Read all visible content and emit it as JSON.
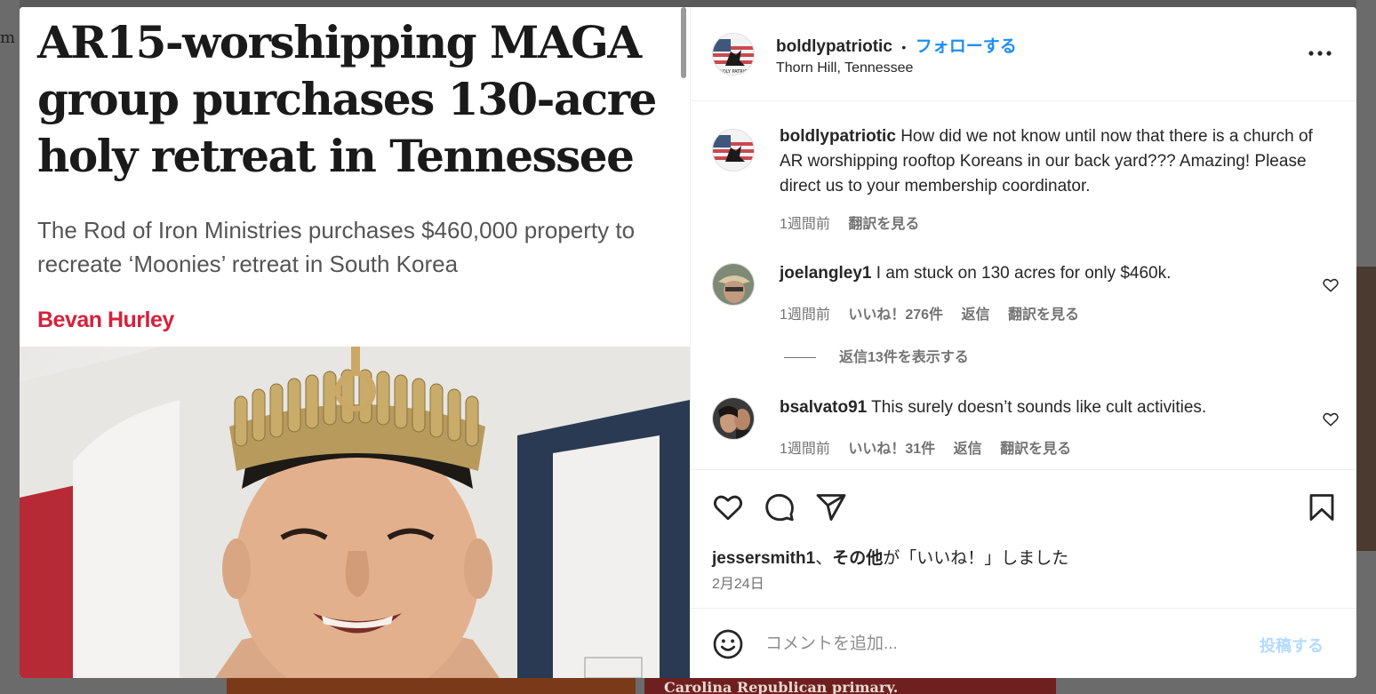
{
  "article": {
    "headline": "AR15-worshipping MAGA group purchases 130-acre holy retreat in Tennessee",
    "subhead": "The Rod of Iron Ministries purchases $460,000 property to recreate ‘Moonies’ retreat in South Korea",
    "byline": "Bevan Hurley"
  },
  "post": {
    "username": "boldlypatriotic",
    "separator": "•",
    "follow_label": "フォローする",
    "location": "Thorn Hill, Tennessee",
    "more_label": "•••"
  },
  "comments": [
    {
      "username": "boldlypatriotic",
      "text": "How did we not know until now that there is a church of AR worshipping rooftop Koreans in our back yard??? Amazing! Please direct us to your membership coordinator.",
      "time": "1週間前",
      "translate": "翻訳を見る"
    },
    {
      "username": "joelangley1",
      "text": "I am stuck on 130 acres for only $460k.",
      "time": "1週間前",
      "likes": "いいね！276件",
      "reply": "返信",
      "translate": "翻訳を見る",
      "view_replies": "返信13件を表示する"
    },
    {
      "username": "bsalvato91",
      "text": "This surely doesn’t sounds like cult activities.",
      "time": "1週間前",
      "likes": "いいね！31件",
      "reply": "返信",
      "translate": "翻訳を見る"
    }
  ],
  "likes_line": {
    "user": "jessersmith1",
    "sep": "、",
    "others": "その他",
    "suffix": "が「いいね！」しました"
  },
  "date": "2月24日",
  "compose": {
    "placeholder": "コメントを追加...",
    "post_label": "投稿する"
  },
  "background": {
    "bottom_headline": "Carolina Republican primary."
  },
  "colors": {
    "follow": "#1f8ef1",
    "byline": "#d5213c",
    "post_disabled": "#b3dbff"
  }
}
